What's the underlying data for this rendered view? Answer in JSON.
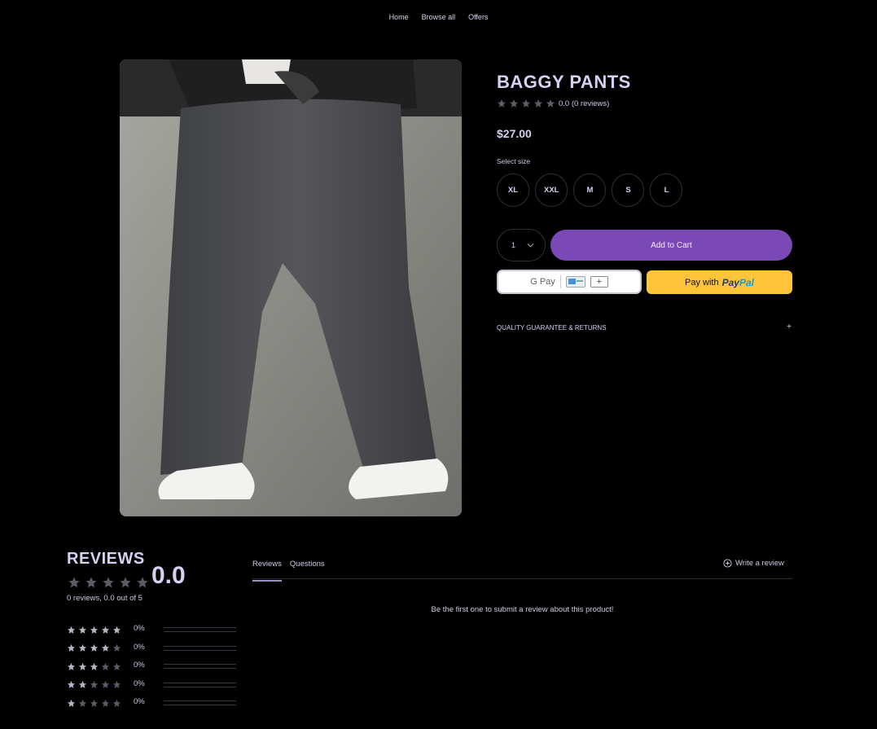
{
  "nav": {
    "items": [
      "Home",
      "Browse all",
      "Offers"
    ]
  },
  "product": {
    "title": "BAGGY PANTS",
    "rating_text": "0.0 (0 reviews)",
    "price": "$27.00",
    "size_label": "Select size",
    "sizes": [
      "XL",
      "XXL",
      "M",
      "S",
      "L"
    ],
    "quantity": "1",
    "add_to_cart": "Add to Cart",
    "gpay_label": "G Pay",
    "paypal_prefix": "Pay with",
    "paypal_brand_1": "Pay",
    "paypal_brand_2": "Pal",
    "accordion_label": "QUALITY GUARANTEE & RETURNS",
    "accordion_icon": "+"
  },
  "reviews": {
    "title": "REVIEWS",
    "score": "0.0",
    "summary": "0 reviews, 0.0 out of 5",
    "distribution": [
      {
        "stars": 5,
        "pct": "0%"
      },
      {
        "stars": 4,
        "pct": "0%"
      },
      {
        "stars": 3,
        "pct": "0%"
      },
      {
        "stars": 2,
        "pct": "0%"
      },
      {
        "stars": 1,
        "pct": "0%"
      }
    ],
    "tabs": [
      "Reviews",
      "Questions"
    ],
    "write_review": "Write a review",
    "empty_message": "Be the first one to submit a review about this product!"
  },
  "colors": {
    "accent": "#7b49b5",
    "star_empty": "#5d5b66",
    "star_filled": "#b9b5c6",
    "paypal": "#ffc439"
  }
}
